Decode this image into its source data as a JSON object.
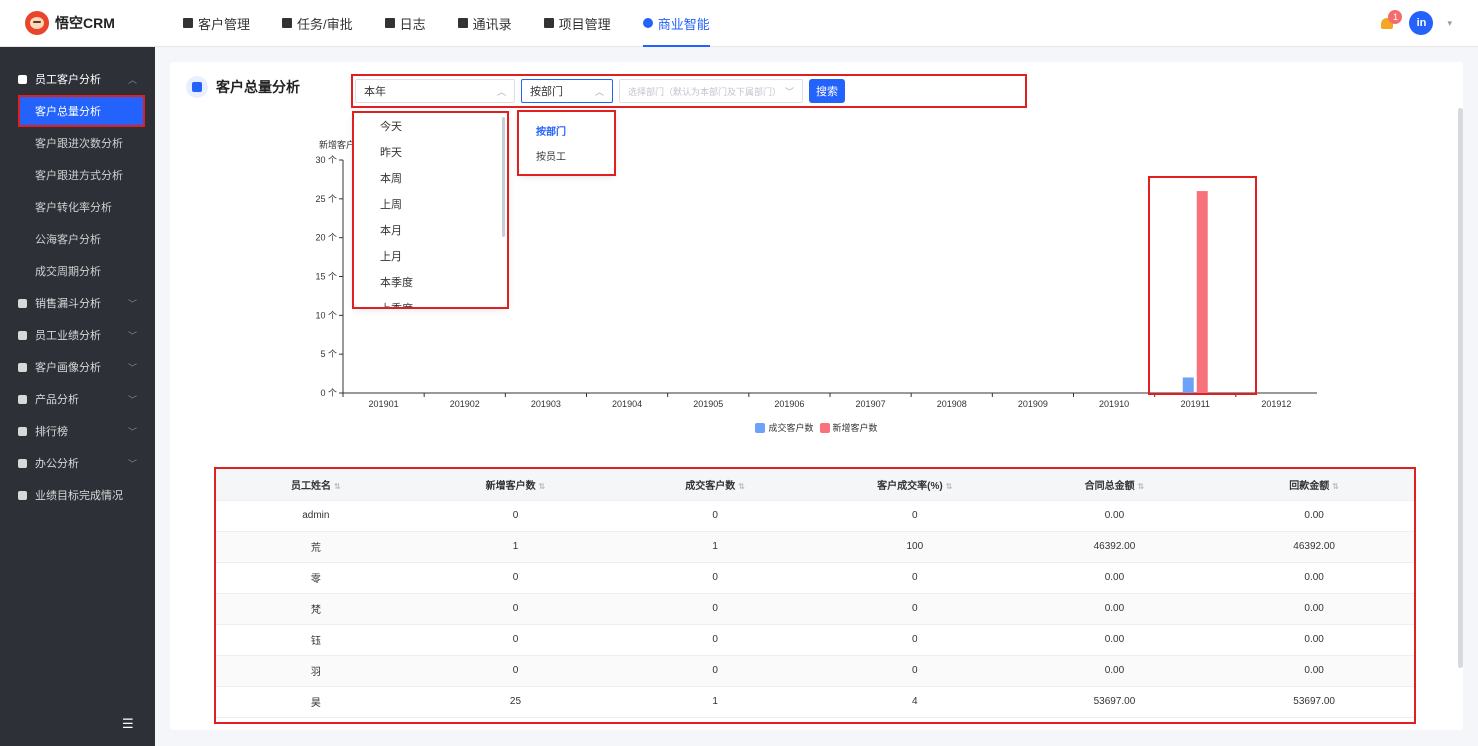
{
  "app": {
    "name": "悟空CRM"
  },
  "nav": [
    {
      "label": "客户管理"
    },
    {
      "label": "任务/审批"
    },
    {
      "label": "日志"
    },
    {
      "label": "通讯录"
    },
    {
      "label": "项目管理"
    },
    {
      "label": "商业智能"
    }
  ],
  "header": {
    "notification_count": "1",
    "avatar_initials": "in"
  },
  "sidebar": {
    "groups": [
      {
        "label": "员工客户分析"
      },
      {
        "label": "销售漏斗分析"
      },
      {
        "label": "员工业绩分析"
      },
      {
        "label": "客户画像分析"
      },
      {
        "label": "产品分析"
      },
      {
        "label": "排行榜"
      },
      {
        "label": "办公分析"
      },
      {
        "label": "业绩目标完成情况"
      }
    ],
    "sub_items": [
      {
        "label": "客户总量分析"
      },
      {
        "label": "客户跟进次数分析"
      },
      {
        "label": "客户跟进方式分析"
      },
      {
        "label": "客户转化率分析"
      },
      {
        "label": "公海客户分析"
      },
      {
        "label": "成交周期分析"
      }
    ]
  },
  "page": {
    "title": "客户总量分析"
  },
  "filters": {
    "time_value": "本年",
    "group_by_value": "按部门",
    "org_placeholder": "选择部门（默认为本部门及下属部门）",
    "search_label": "搜索"
  },
  "time_options": [
    "今天",
    "昨天",
    "本周",
    "上周",
    "本月",
    "上月",
    "本季度",
    "上季度"
  ],
  "group_options": [
    "按部门",
    "按员工"
  ],
  "chart_data": {
    "type": "bar",
    "ylabel": "新增客户",
    "ylim": [
      0,
      30
    ],
    "y_ticks": [
      "0 个",
      "5 个",
      "10 个",
      "15 个",
      "20 个",
      "25 个",
      "30 个"
    ],
    "categories": [
      "201901",
      "201902",
      "201903",
      "201904",
      "201905",
      "201906",
      "201907",
      "201908",
      "201909",
      "201910",
      "201911",
      "201912"
    ],
    "series": [
      {
        "name": "成交客户数",
        "color": "#6ca2f7",
        "values": [
          0,
          0,
          0,
          0,
          0,
          0,
          0,
          0,
          0,
          0,
          2,
          0
        ]
      },
      {
        "name": "新增客户数",
        "color": "#f7727b",
        "values": [
          0,
          0,
          0,
          0,
          0,
          0,
          0,
          0,
          0,
          0,
          26,
          0
        ]
      }
    ],
    "legend": "bottom"
  },
  "table": {
    "headers": [
      "员工姓名",
      "新增客户数",
      "成交客户数",
      "客户成交率(%)",
      "合同总金额",
      "回款金额"
    ],
    "rows": [
      [
        "admin",
        "0",
        "0",
        "0",
        "0.00",
        "0.00"
      ],
      [
        "荒",
        "1",
        "1",
        "100",
        "46392.00",
        "46392.00"
      ],
      [
        "零",
        "0",
        "0",
        "0",
        "0.00",
        "0.00"
      ],
      [
        "梵",
        "0",
        "0",
        "0",
        "0.00",
        "0.00"
      ],
      [
        "钰",
        "0",
        "0",
        "0",
        "0.00",
        "0.00"
      ],
      [
        "羽",
        "0",
        "0",
        "0",
        "0.00",
        "0.00"
      ],
      [
        "昊",
        "25",
        "1",
        "4",
        "53697.00",
        "53697.00"
      ]
    ]
  },
  "colors": {
    "accent": "#2362fb",
    "sidebar_bg": "#2d3037",
    "highlight": "#e02020"
  }
}
